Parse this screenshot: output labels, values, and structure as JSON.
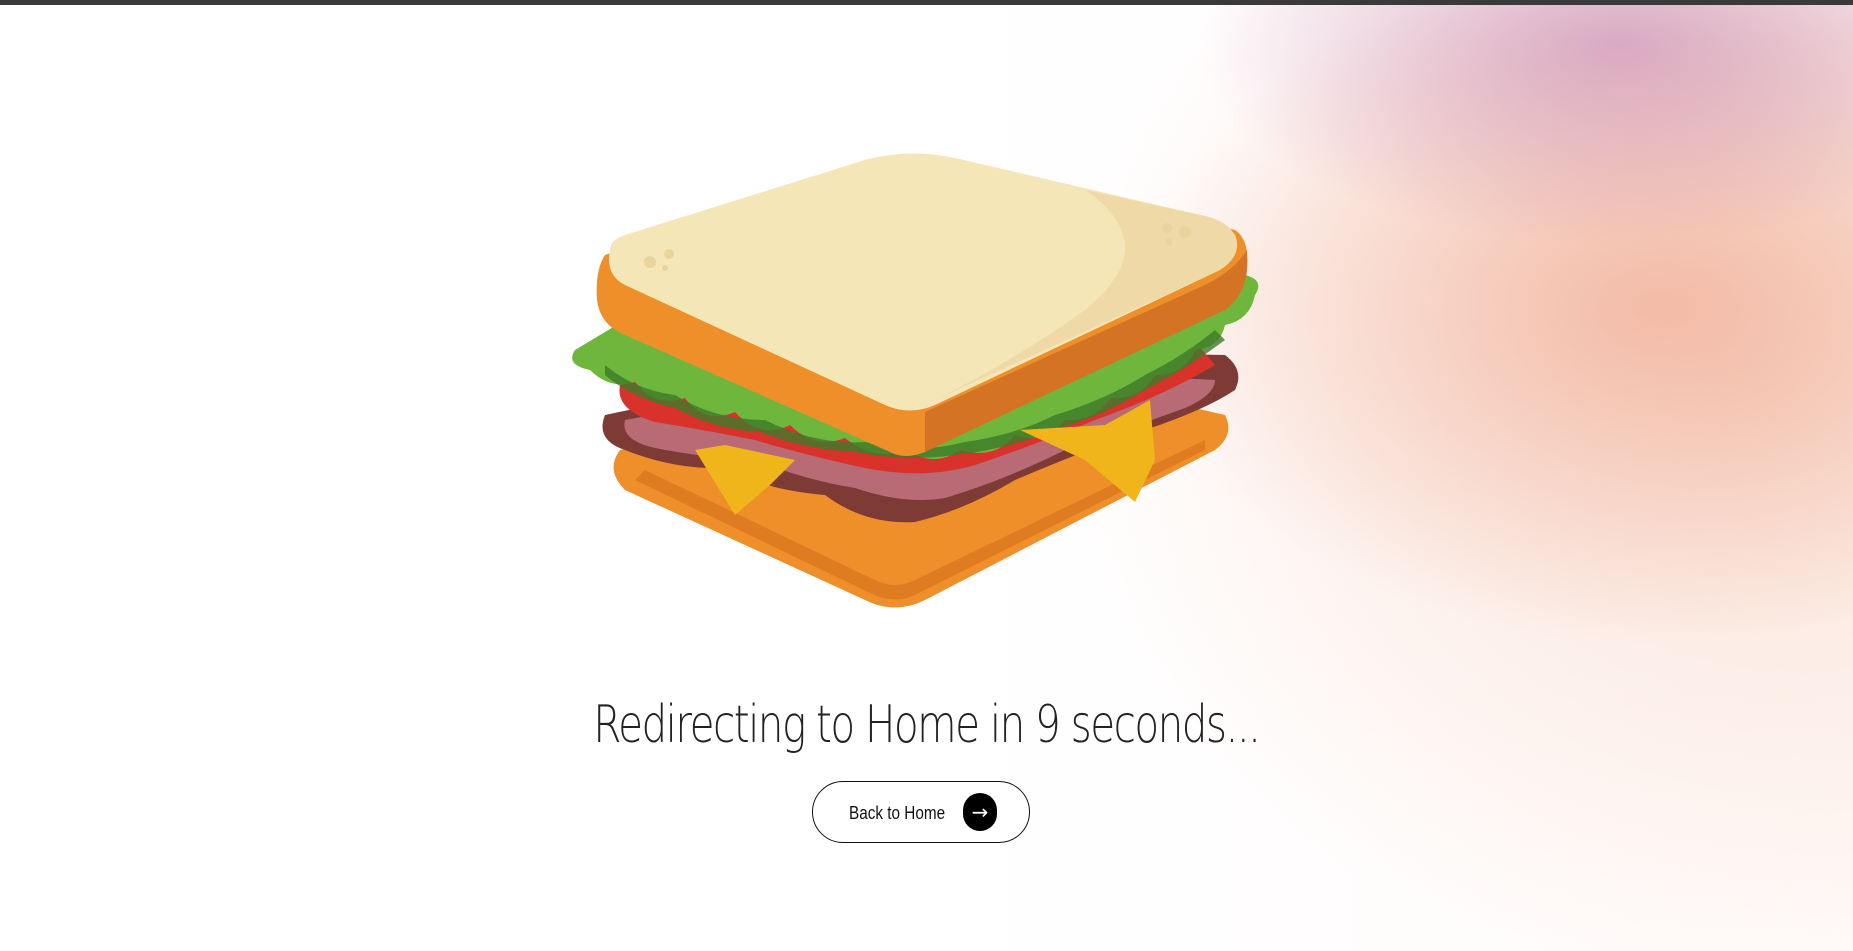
{
  "redirect": {
    "message": "Redirecting to Home in 9 seconds..."
  },
  "actions": {
    "back_home_label": "Back to Home",
    "arrow_glyph": "→"
  },
  "illustration": {
    "subject": "sandwich-illustration"
  },
  "colors": {
    "text": "#222222",
    "button_border": "#111111",
    "arrow_bg": "#000000",
    "bread": "#F5E6B8",
    "crust": "#EE8F2A",
    "lettuce": "#6FB63D",
    "tomato": "#D8322B",
    "ham": "#A4545E",
    "cheese": "#F1B51C",
    "glow_pink": "#C67CB0",
    "glow_peach": "#EE9A7C"
  }
}
